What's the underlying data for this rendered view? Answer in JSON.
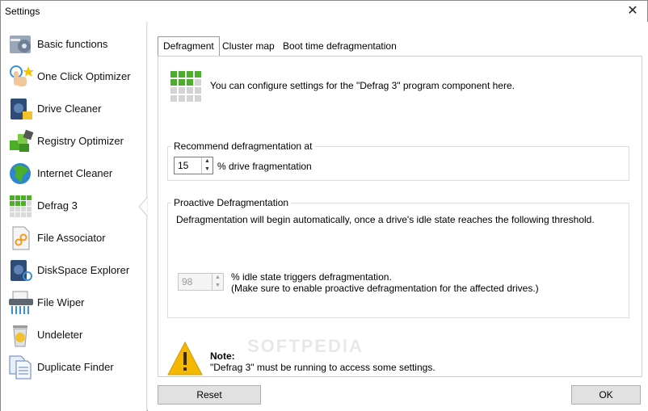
{
  "window": {
    "title": "Settings",
    "close_glyph": "✕"
  },
  "sidebar": {
    "items": [
      {
        "label": "Basic functions",
        "icon": "gear-wrench-icon"
      },
      {
        "label": "One Click Optimizer",
        "icon": "hand-click-icon"
      },
      {
        "label": "Drive Cleaner",
        "icon": "drive-broom-icon"
      },
      {
        "label": "Registry Optimizer",
        "icon": "registry-cubes-icon"
      },
      {
        "label": "Internet Cleaner",
        "icon": "globe-icon"
      },
      {
        "label": "Defrag 3",
        "icon": "defrag-grid-icon"
      },
      {
        "label": "File Associator",
        "icon": "file-link-icon"
      },
      {
        "label": "DiskSpace Explorer",
        "icon": "disk-explorer-icon"
      },
      {
        "label": "File Wiper",
        "icon": "shredder-icon"
      },
      {
        "label": "Undeleter",
        "icon": "trash-restore-icon"
      },
      {
        "label": "Duplicate Finder",
        "icon": "duplicate-docs-icon"
      }
    ],
    "selected": "Defrag 3"
  },
  "tabs": [
    {
      "label": "Defragment",
      "active": true
    },
    {
      "label": "Cluster map",
      "active": false
    },
    {
      "label": "Boot time defragmentation",
      "active": false
    }
  ],
  "intro": {
    "text": "You can configure settings for the \"Defrag 3\" program component here."
  },
  "recommend": {
    "title": "Recommend defragmentation at",
    "value": "15",
    "suffix": "% drive fragmentation"
  },
  "proactive": {
    "title": "Proactive Defragmentation",
    "description": "Defragmentation will begin automatically, once a drive's idle state reaches the following threshold.",
    "value": "98",
    "suffix_line1": "% idle state triggers defragmentation.",
    "suffix_line2": "(Make sure to enable proactive defragmentation for the affected drives.)"
  },
  "note": {
    "heading": "Note:",
    "text": "\"Defrag 3\" must be running to access some settings.",
    "watermark": "SOFTPEDIA"
  },
  "buttons": {
    "reset": "Reset",
    "ok": "OK"
  },
  "spinner_glyphs": {
    "up": "▲",
    "down": "▼"
  },
  "colors": {
    "accent": "#7a9ed3",
    "defrag_green": "#4caf2a"
  }
}
